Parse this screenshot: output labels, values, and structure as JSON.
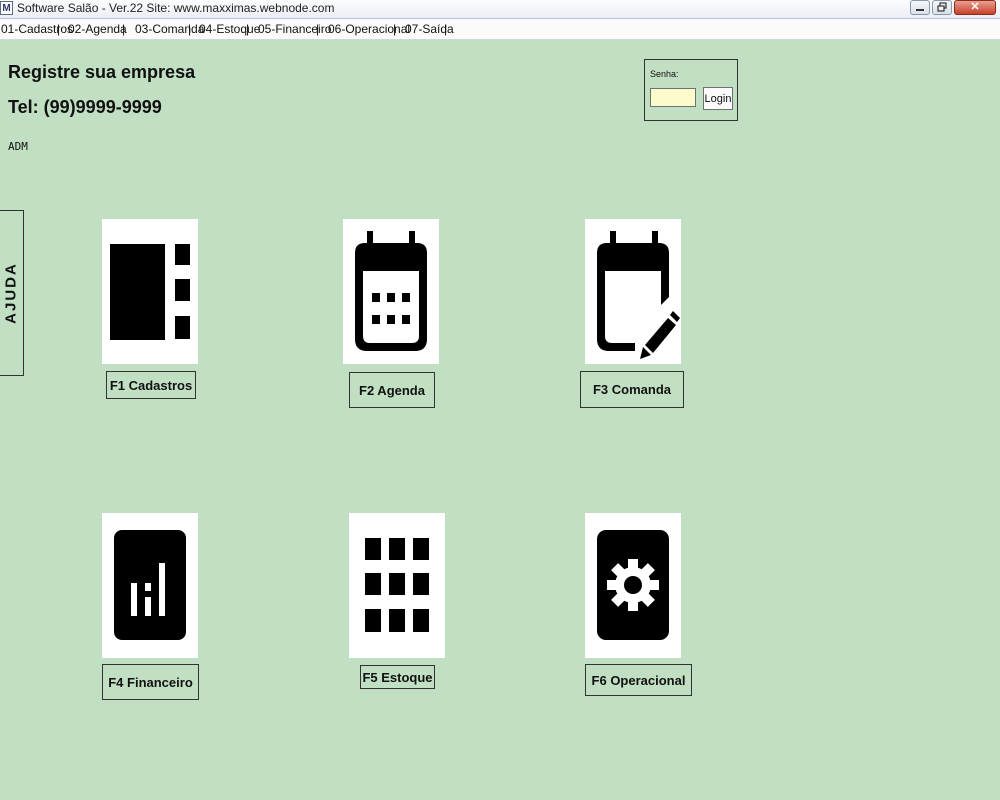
{
  "window": {
    "app_icon": "M",
    "title": "Software Salão - Ver.22 Site: www.maxximas.webnode.com",
    "close_glyph": "✕"
  },
  "menu": [
    {
      "label": "01-Cadastros"
    },
    {
      "label": "02-Agenda"
    },
    {
      "label": "03-Comanda"
    },
    {
      "label": "04-Estoque"
    },
    {
      "label": "05-Financeiro"
    },
    {
      "label": "06-Operacional"
    },
    {
      "label": "07-Saída"
    }
  ],
  "company": {
    "name": "Registre sua empresa",
    "phone": "Tel: (99)9999-9999",
    "user": "ADM"
  },
  "login": {
    "label": "Senha:",
    "password_value": "",
    "button_label": "Login"
  },
  "help_tab": {
    "label": "AJUDA"
  },
  "tiles": [
    {
      "label": "F1 Cadastros",
      "icon": "list-icon"
    },
    {
      "label": "F2 Agenda",
      "icon": "calendar-icon"
    },
    {
      "label": "F3 Comanda",
      "icon": "calendar-edit-icon"
    },
    {
      "label": "F4 Financeiro",
      "icon": "signal-bars-icon"
    },
    {
      "label": "F5 Estoque",
      "icon": "grid-icon"
    },
    {
      "label": "F6 Operacional",
      "icon": "gear-icon"
    }
  ],
  "colors": {
    "background": "#c1dfc3",
    "input_background": "#fcfbcb"
  }
}
